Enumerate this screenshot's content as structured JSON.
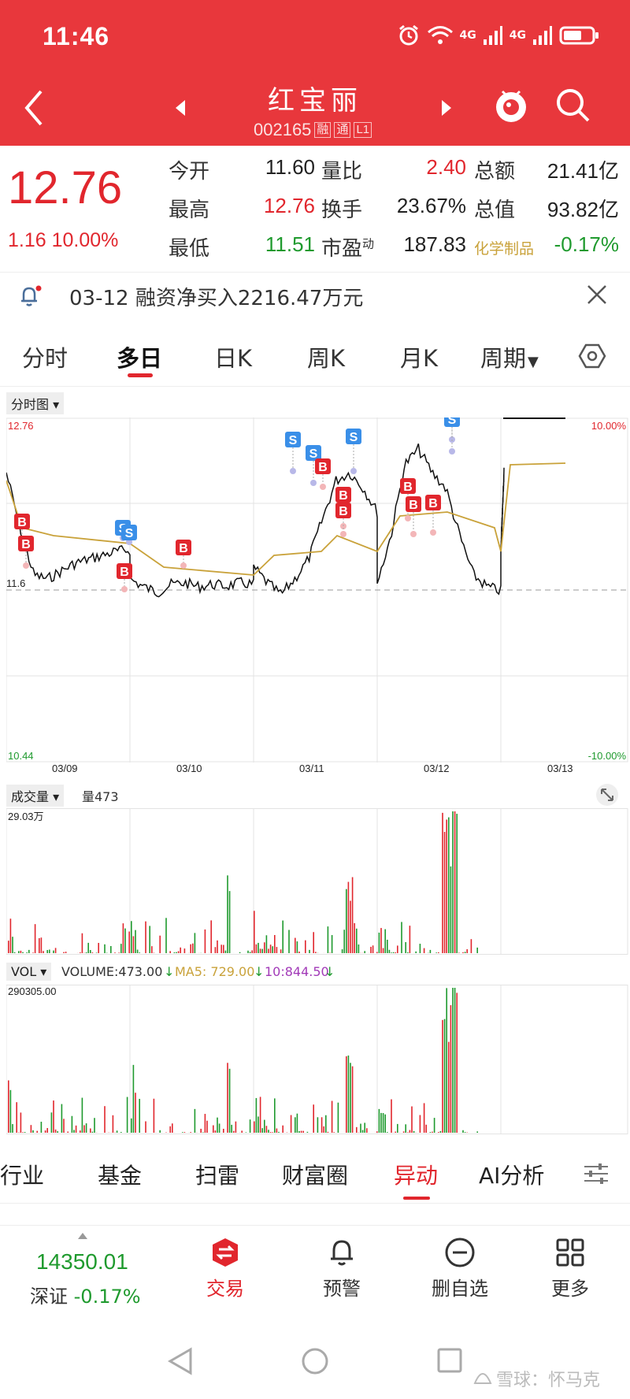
{
  "status_bar": {
    "time": "11:46",
    "network_1": "4G",
    "network_2": "4G"
  },
  "header": {
    "stock_name": "红宝丽",
    "stock_code": "002165",
    "tag_1": "融",
    "tag_2": "通",
    "tag_3": "L1"
  },
  "quote": {
    "price": "12.76",
    "change": "1.16  10.00%",
    "rows": [
      {
        "l1": "今开",
        "v1": "11.60",
        "l2": "量比",
        "v2": "2.40",
        "l3": "总额",
        "v3": "21.41亿"
      },
      {
        "l1": "最高",
        "v1": "12.76",
        "l2": "换手",
        "v2": "23.67%",
        "l3": "总值",
        "v3": "93.82亿"
      },
      {
        "l1": "最低",
        "v1": "11.51",
        "l2": "市盈",
        "l2_sup": "动",
        "v2": "187.83",
        "l3": "化学制品",
        "v3": "-0.17%"
      }
    ]
  },
  "notice": {
    "text": "03-12 融资净买入2216.47万元"
  },
  "tabs": [
    "分时",
    "多日",
    "日K",
    "周K",
    "月K",
    "周期"
  ],
  "colors": {
    "brand_red": "#e8373c",
    "up": "#e1262d",
    "down": "#1f9a2e",
    "avg_line": "#c9a23a",
    "buy_marker": "#e1262d",
    "sell_marker": "#3a8fe8"
  },
  "price_chart": {
    "selector": "分时图",
    "y_top": "12.76",
    "y_mid": "11.6",
    "y_bottom": "10.44",
    "pct_top": "10.00%",
    "pct_bottom": "-10.00%",
    "dates": [
      "03/09",
      "03/10",
      "03/11",
      "03/12",
      "03/13"
    ],
    "buy_label": "B",
    "sell_label": "S"
  },
  "volume_chart": {
    "selector": "成交量",
    "vol_label": "量473",
    "y_top": "29.03万"
  },
  "vol_indicator": {
    "selector": "VOL",
    "volume": "VOLUME:473.00",
    "ma5": "MA5: 729.00",
    "ma10": "10:844.50",
    "y_top": "290305.00"
  },
  "bottom_tabs": [
    "行业",
    "基金",
    "扫雷",
    "财富圈",
    "异动",
    "AI分析"
  ],
  "footer": {
    "index_value": "14350.01",
    "index_name": "深证",
    "index_change": "-0.17%",
    "items": [
      "交易",
      "预警",
      "删自选",
      "更多"
    ]
  },
  "watermark": "雪球：怀马克"
}
